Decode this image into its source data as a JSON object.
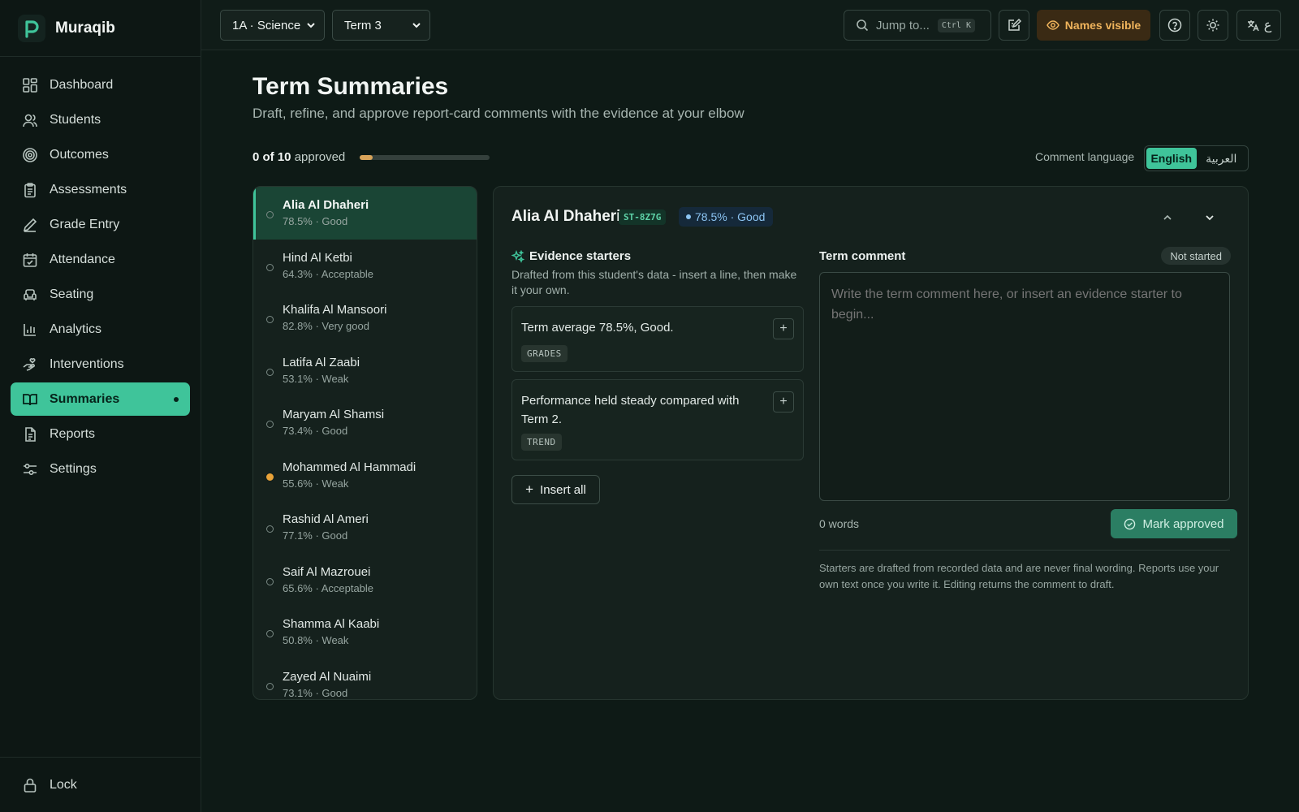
{
  "brand": {
    "name": "Muraqib"
  },
  "sidebar": {
    "items": [
      {
        "label": "Dashboard",
        "icon": "grid-icon"
      },
      {
        "label": "Students",
        "icon": "users-icon"
      },
      {
        "label": "Outcomes",
        "icon": "target-icon"
      },
      {
        "label": "Assessments",
        "icon": "clipboard-icon"
      },
      {
        "label": "Grade Entry",
        "icon": "pen-icon"
      },
      {
        "label": "Attendance",
        "icon": "calendar-check-icon"
      },
      {
        "label": "Seating",
        "icon": "armchair-icon"
      },
      {
        "label": "Analytics",
        "icon": "bar-chart-icon"
      },
      {
        "label": "Interventions",
        "icon": "hand-heart-icon"
      },
      {
        "label": "Summaries",
        "icon": "book-open-icon",
        "active": true
      },
      {
        "label": "Reports",
        "icon": "file-text-icon"
      },
      {
        "label": "Settings",
        "icon": "sliders-icon"
      }
    ],
    "lock_label": "Lock"
  },
  "topbar": {
    "class_select": "1A · Science",
    "term_select": "Term 3",
    "search_placeholder": "Jump to...",
    "search_shortcut": "Ctrl K",
    "names_visible": "Names visible",
    "lang_glyph": "ع"
  },
  "page": {
    "title": "Term Summaries",
    "subtitle": "Draft, refine, and approve report-card comments with the evidence at your elbow",
    "approved_count": "0 of 10",
    "approved_suffix": "approved",
    "approved_fraction": 0.1,
    "comment_language_label": "Comment language",
    "languages": [
      "English",
      "العربية"
    ],
    "selected_language": "English"
  },
  "students": [
    {
      "name": "Alia Al Dhaheri",
      "meta": "78.5% · Good",
      "active": true,
      "status": "empty"
    },
    {
      "name": "Hind Al Ketbi",
      "meta": "64.3% · Acceptable",
      "status": "empty"
    },
    {
      "name": "Khalifa Al Mansoori",
      "meta": "82.8% · Very good",
      "status": "empty"
    },
    {
      "name": "Latifa Al Zaabi",
      "meta": "53.1% · Weak",
      "status": "empty"
    },
    {
      "name": "Maryam Al Shamsi",
      "meta": "73.4% · Good",
      "status": "empty"
    },
    {
      "name": "Mohammed Al Hammadi",
      "meta": "55.6% · Weak",
      "status": "flagged"
    },
    {
      "name": "Rashid Al Ameri",
      "meta": "77.1% · Good",
      "status": "empty"
    },
    {
      "name": "Saif Al Mazrouei",
      "meta": "65.6% · Acceptable",
      "status": "empty"
    },
    {
      "name": "Shamma Al Kaabi",
      "meta": "50.8% · Weak",
      "status": "empty"
    },
    {
      "name": "Zayed Al Nuaimi",
      "meta": "73.1% · Good",
      "status": "empty"
    }
  ],
  "detail": {
    "name": "Alia Al Dhaheri",
    "id": "ST-8Z7G",
    "grade": "78.5% · Good",
    "evidence_title": "Evidence starters",
    "evidence_desc": "Drafted from this student's data - insert a line, then make it your own.",
    "starters": [
      {
        "text": "Term average 78.5%, Good.",
        "tag": "GRADES"
      },
      {
        "text": "Performance held steady compared with Term 2.",
        "tag": "TREND"
      }
    ],
    "insert_all": "Insert all",
    "term_comment_label": "Term comment",
    "status": "Not started",
    "comment_placeholder": "Write the term comment here, or insert an evidence starter to begin...",
    "comment_value": "",
    "word_count": "0 words",
    "approve_label": "Mark approved",
    "footnote": "Starters are drafted from recorded data and are never final wording. Reports use your own text once you write it. Editing returns the comment to draft."
  }
}
